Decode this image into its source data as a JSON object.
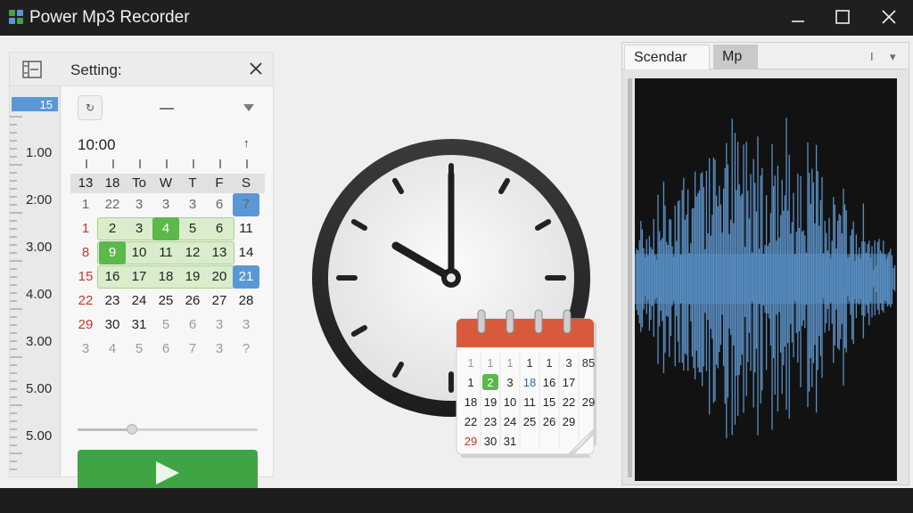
{
  "window": {
    "title": "Power Mp3 Recorder",
    "controls": [
      "minimize",
      "maximize",
      "close"
    ]
  },
  "settings_panel": {
    "title": "Setting:",
    "ruler": {
      "tag": "15",
      "labels": [
        "1.00",
        "2:00",
        "3.00",
        "4.00",
        "3.00",
        "5.00",
        "5.00"
      ]
    },
    "nav_button_icon": "rotate-icon",
    "time": "10:00",
    "time_up_glyph": "↑",
    "calendar": {
      "headers": [
        "13",
        "18",
        "To",
        "W",
        "T",
        "F",
        "S"
      ],
      "rows": [
        [
          "1",
          "22",
          "3",
          "3",
          "3",
          "6",
          "7"
        ],
        [
          "1",
          "2",
          "3",
          "4",
          "5",
          "6",
          "11"
        ],
        [
          "8",
          "9",
          "10",
          "11",
          "12",
          "13",
          "14"
        ],
        [
          "15",
          "16",
          "17",
          "18",
          "19",
          "20",
          "21"
        ],
        [
          "22",
          "23",
          "24",
          "25",
          "26",
          "27",
          "28"
        ],
        [
          "29",
          "30",
          "31",
          "5",
          "6",
          "3",
          "3"
        ],
        [
          "3",
          "4",
          "5",
          "6",
          "7",
          "3",
          "?"
        ]
      ]
    },
    "slider_value": 0.3,
    "play_button": "play-icon"
  },
  "illustration": {
    "clock_time": "10:00",
    "mini_calendar": {
      "rows": [
        [
          "1",
          "1",
          "1",
          "1",
          "1",
          "3",
          "85"
        ],
        [
          "1",
          "2",
          "3",
          "18",
          "16",
          "17",
          ""
        ],
        [
          "18",
          "19",
          "10",
          "11",
          "15",
          "22",
          "29"
        ],
        [
          "22",
          "23",
          "24",
          "25",
          "26",
          "29",
          ""
        ],
        [
          "29",
          "30",
          "31",
          "",
          "",
          "",
          ""
        ]
      ]
    }
  },
  "waveform_panel": {
    "tabs": [
      "Scendar",
      "Mp"
    ],
    "tab_controls": [
      "I",
      "▾"
    ],
    "colors": {
      "wave": "#5a8fc4",
      "background": "#121212"
    }
  },
  "colors": {
    "accent_blue": "#5a97d6",
    "accent_green": "#3fa444",
    "calendar_red": "#c0392b"
  }
}
